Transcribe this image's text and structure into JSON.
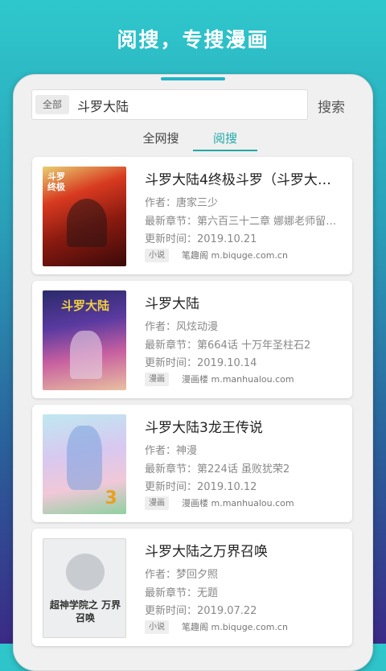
{
  "hero": {
    "title": "阅搜，专搜漫画"
  },
  "search": {
    "scope_label": "全部",
    "query": "斗罗大陆",
    "button_label": "搜索"
  },
  "tabs": [
    {
      "label": "全网搜",
      "active": false
    },
    {
      "label": "阅搜",
      "active": true
    }
  ],
  "accent_color": "#20a8a8",
  "results": [
    {
      "title": "斗罗大陆4终极斗罗（斗罗大…",
      "author_label": "作者：",
      "author": "唐家三少",
      "chapter_label": "最新章节：",
      "chapter": "第六百三十二章 娜娜老师留…",
      "updated_label": "更新时间：",
      "updated": "2019.10.21",
      "tag": "小说",
      "source": "笔趣阁 m.biquge.com.cn",
      "cover_text": "斗罗 终极"
    },
    {
      "title": "斗罗大陆",
      "author_label": "作者：",
      "author": "风炫动漫",
      "chapter_label": "最新章节：",
      "chapter": "第664话 十万年圣柱石2",
      "updated_label": "更新时间：",
      "updated": "2019.10.14",
      "tag": "漫画",
      "source": "漫画楼 m.manhualou.com",
      "cover_text": "斗罗大陆"
    },
    {
      "title": "斗罗大陆3龙王传说",
      "author_label": "作者：",
      "author": "神漫",
      "chapter_label": "最新章节：",
      "chapter": "第224话 虽败犹荣2",
      "updated_label": "更新时间：",
      "updated": "2019.10.12",
      "tag": "漫画",
      "source": "漫画楼 m.manhualou.com",
      "cover_text": "3"
    },
    {
      "title": "斗罗大陆之万界召唤",
      "author_label": "作者：",
      "author": "梦回夕照",
      "chapter_label": "最新章节：",
      "chapter": "无题",
      "updated_label": "更新时间：",
      "updated": "2019.07.22",
      "tag": "小说",
      "source": "笔趣阁 m.biquge.com.cn",
      "cover_text": "超神学院之 万界召唤"
    }
  ]
}
